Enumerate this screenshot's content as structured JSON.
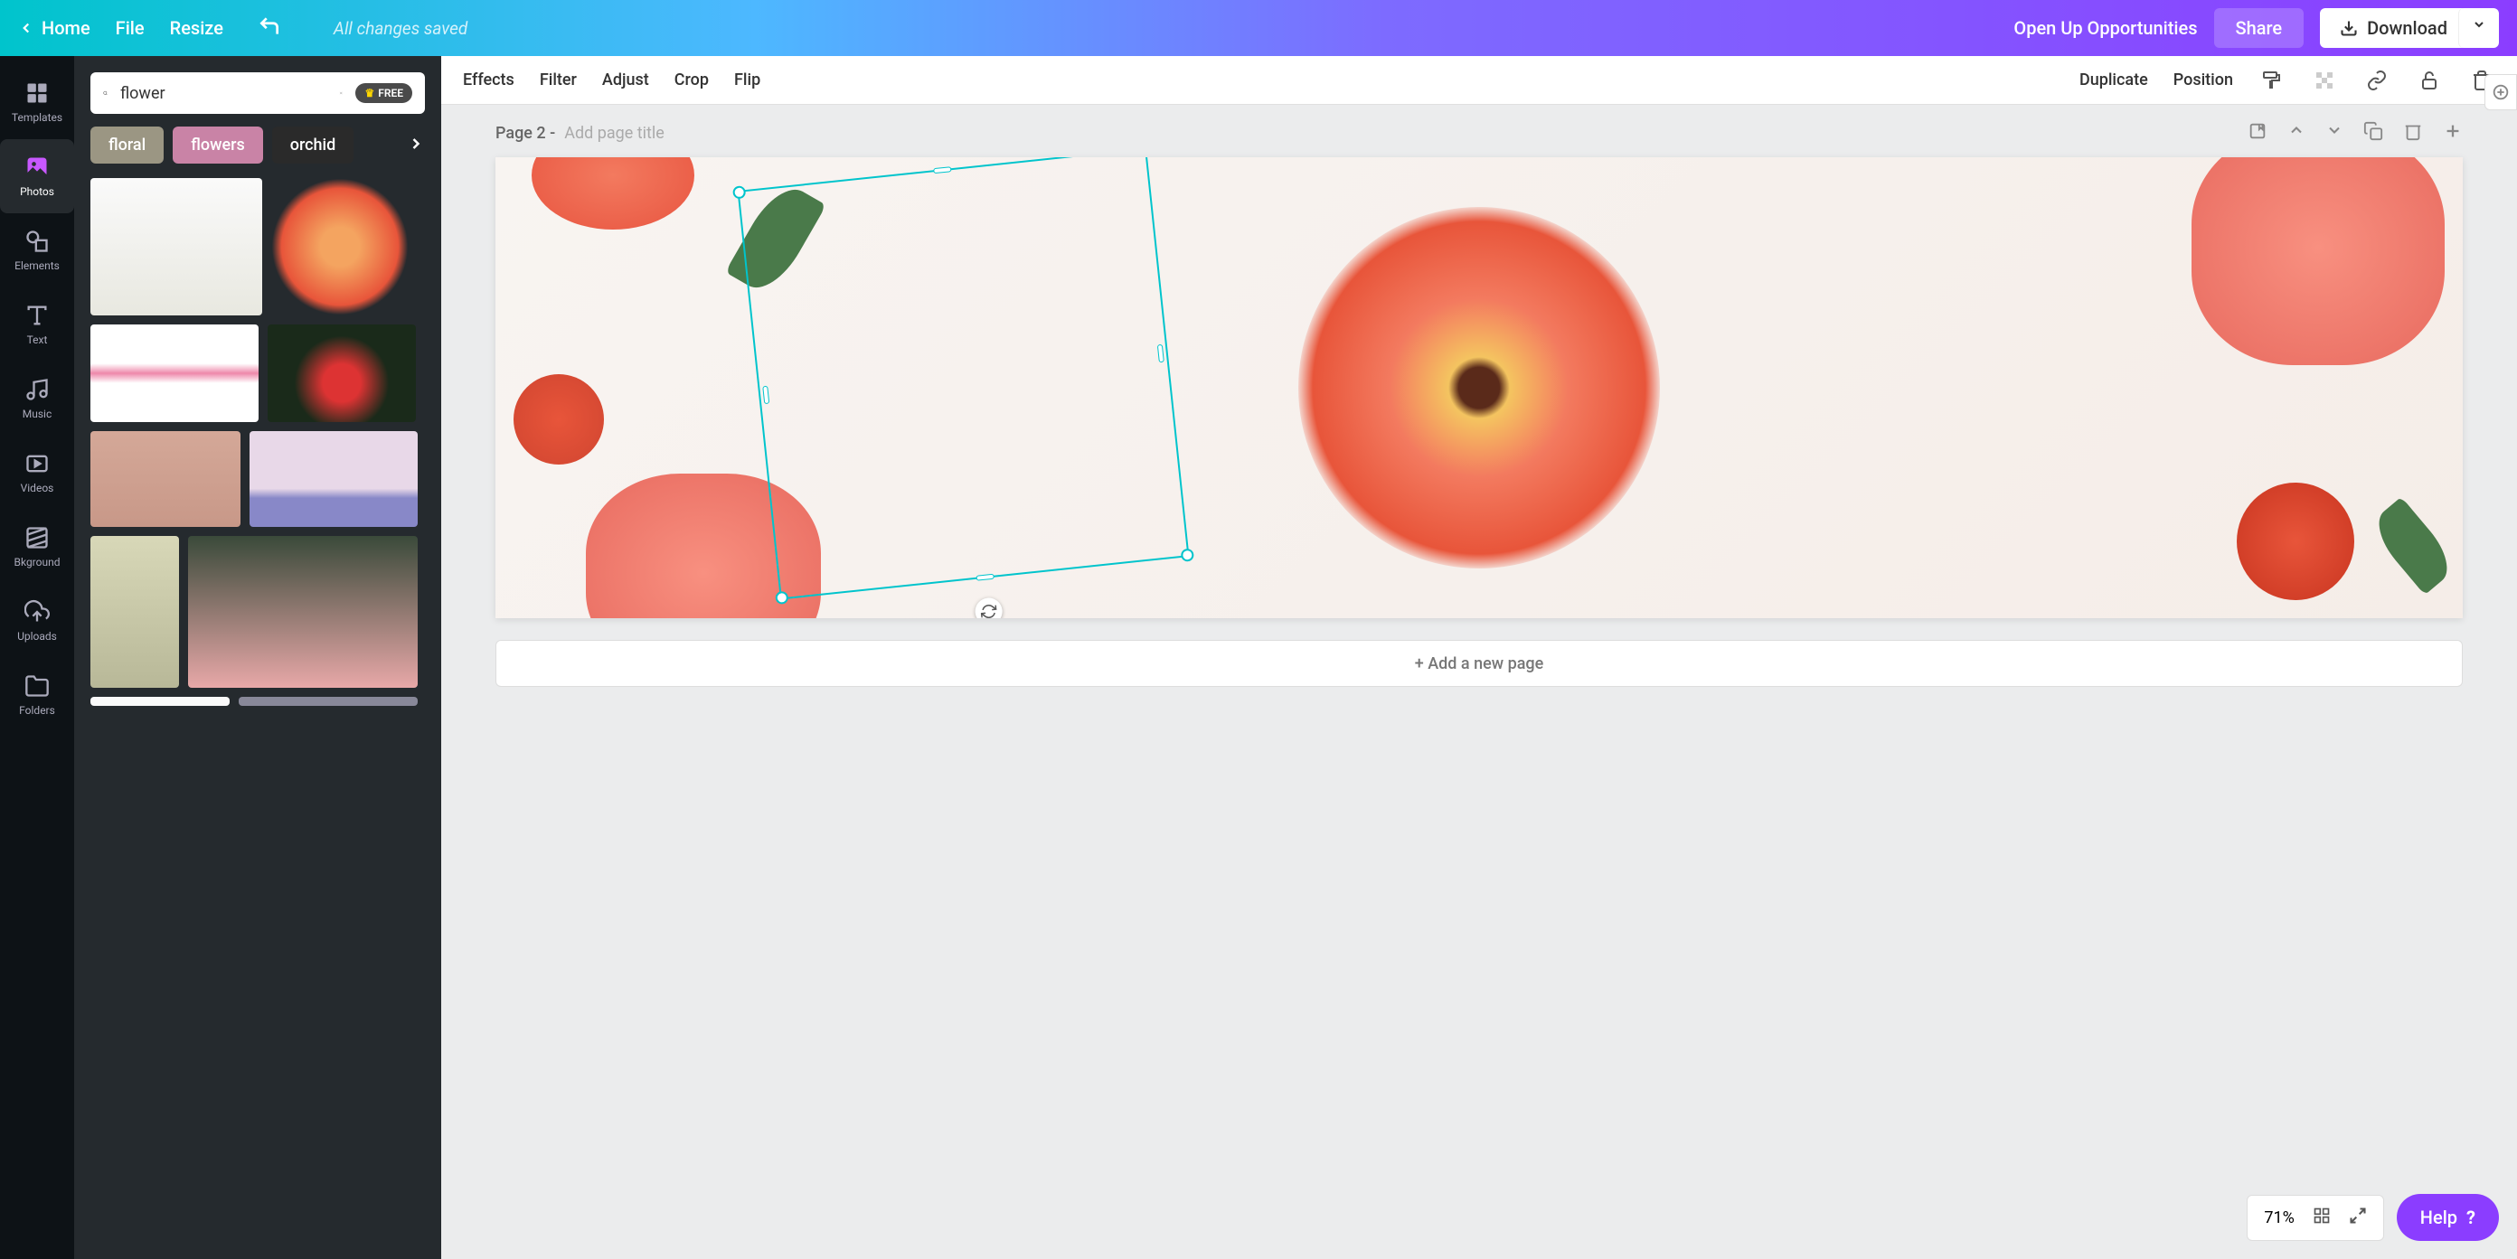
{
  "topbar": {
    "home": "Home",
    "file": "File",
    "resize": "Resize",
    "saved": "All changes saved",
    "opportunities": "Open Up Opportunities",
    "share": "Share",
    "download": "Download"
  },
  "rail": {
    "templates": "Templates",
    "photos": "Photos",
    "elements": "Elements",
    "text": "Text",
    "music": "Music",
    "videos": "Videos",
    "bkground": "Bkground",
    "uploads": "Uploads",
    "folders": "Folders"
  },
  "search": {
    "value": "flower",
    "free": "FREE"
  },
  "tags": {
    "t1": "floral",
    "t2": "flowers",
    "t3": "orchid"
  },
  "toolbar": {
    "effects": "Effects",
    "filter": "Filter",
    "adjust": "Adjust",
    "crop": "Crop",
    "flip": "Flip",
    "duplicate": "Duplicate",
    "position": "Position"
  },
  "page": {
    "label": "Page 2 -",
    "titlePh": "Add page title",
    "addPage": "+ Add a new page"
  },
  "bottom": {
    "zoom": "71%",
    "help": "Help"
  }
}
